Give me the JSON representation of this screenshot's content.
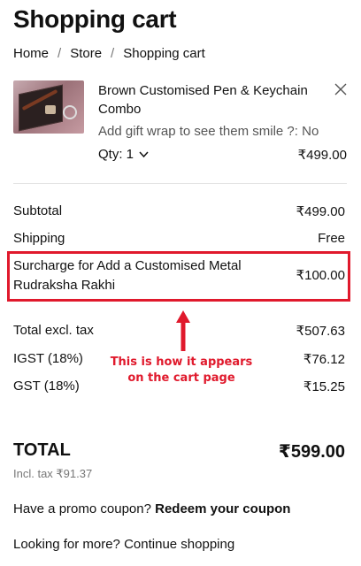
{
  "page": {
    "title": "Shopping cart"
  },
  "breadcrumb": {
    "home": "Home",
    "store": "Store",
    "current": "Shopping cart",
    "separator": "/"
  },
  "item": {
    "name": "Brown Customised Pen & Keychain Combo",
    "gift_wrap": "Add gift wrap to see them smile ?: No",
    "qty_label": "Qty: 1",
    "price": "₹499.00",
    "image_icon": "product-thumbnail",
    "remove_icon": "close-icon"
  },
  "summary": {
    "subtotal_label": "Subtotal",
    "subtotal_value": "₹499.00",
    "shipping_label": "Shipping",
    "shipping_value": "Free",
    "surcharge_label": "Surcharge for Add a Customised Metal Rudraksha Rakhi",
    "surcharge_value": "₹100.00",
    "excl_tax_label": "Total excl. tax",
    "excl_tax_value": "₹507.63",
    "igst_label": "IGST (18%)",
    "igst_value": "₹76.12",
    "gst_label": "GST (18%)",
    "gst_value": "₹15.25"
  },
  "annotation": {
    "text": "This is how it appears on the cart page",
    "color": "#e0192c"
  },
  "total": {
    "label": "TOTAL",
    "value": "₹599.00",
    "incl_tax": "Incl. tax ₹91.37"
  },
  "promo": {
    "prefix": "Have a promo coupon?",
    "link": "Redeem your coupon"
  },
  "more": {
    "prefix": "Looking for more?",
    "link": "Continue shopping"
  }
}
